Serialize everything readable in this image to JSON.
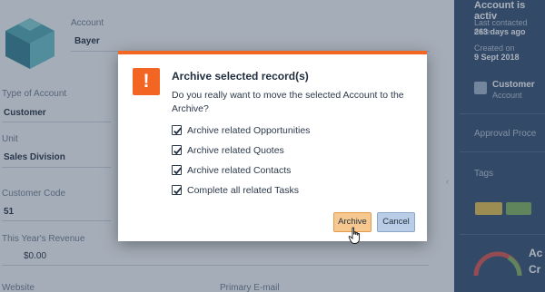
{
  "background": {
    "account_label": "Account",
    "account_value": "Bayer",
    "type_label": "Type of Account",
    "type_value": "Customer",
    "unit_label": "Unit",
    "unit_value": "Sales Division",
    "customer_code_label": "Customer Code",
    "customer_code_value": "51",
    "revenue_label": "This Year's Revenue",
    "revenue_value": "$0.00",
    "website_label": "Website",
    "email_label": "Primary E-mail",
    "right_panel": {
      "status": "Account is activ",
      "last_contacted_label": "Last contacted date",
      "last_contacted_value": "263 days ago",
      "created_label": "Created on",
      "created_value": "9 Sept 2018",
      "customer_title": "Customer",
      "customer_sub": "Account",
      "approval": "Approval Proce",
      "tags": "Tags",
      "tag_colors": [
        "#e6c14a",
        "#7fb25a"
      ],
      "kpi_short": "Ac",
      "kpi_short2": "Cr"
    }
  },
  "dialog": {
    "icon": "exclamation-icon",
    "accent_color": "#f26522",
    "title": "Archive selected record(s)",
    "message": "Do you really want to move the selected Account to the Archive?",
    "options": [
      {
        "label": "Archive related Opportunities",
        "checked": true
      },
      {
        "label": "Archive related Quotes",
        "checked": true
      },
      {
        "label": "Archive related Contacts",
        "checked": true
      },
      {
        "label": "Complete all related Tasks",
        "checked": true
      }
    ],
    "archive_label": "Archive",
    "cancel_label": "Cancel"
  }
}
